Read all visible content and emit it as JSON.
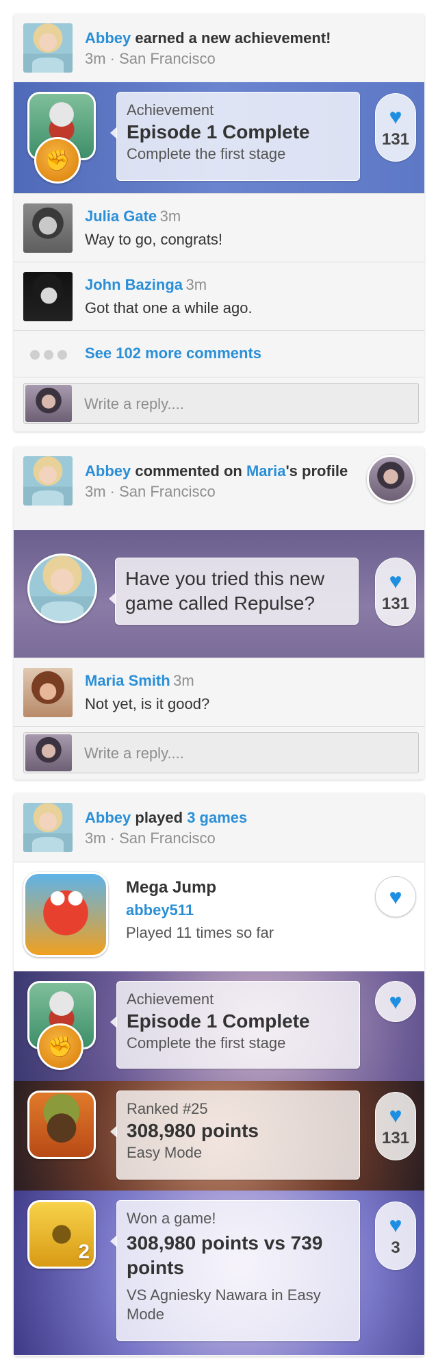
{
  "colors": {
    "link": "#2a8fd6",
    "heart": "#1e8fe0",
    "card_bg": "#f5f5f6"
  },
  "card1": {
    "actor": "Abbey",
    "action": "earned a new achievement!",
    "meta": "3m · San Francisco",
    "achievement": {
      "label": "Achievement",
      "title": "Episode 1 Complete",
      "description": "Complete the first stage",
      "likes": "131"
    },
    "comments": [
      {
        "name": "Julia Gate",
        "time": "3m",
        "text": "Way to go, congrats!"
      },
      {
        "name": "John Bazinga",
        "time": "3m",
        "text": "Got that one a while ago."
      }
    ],
    "more_comments": "See 102 more comments",
    "reply_placeholder": "Write a reply...."
  },
  "card2": {
    "actor": "Abbey",
    "action_pre": "commented on",
    "target": "Maria",
    "action_post": "'s profile",
    "meta": "3m · San Francisco",
    "post_text": "Have you tried this new game called Repulse?",
    "likes": "131",
    "comments": [
      {
        "name": "Maria Smith",
        "time": "3m",
        "text": "Not yet, is it good?"
      }
    ],
    "reply_placeholder": "Write a reply...."
  },
  "card3": {
    "actor": "Abbey",
    "action": "played",
    "games_link": "3 games",
    "meta": "3m · San Francisco",
    "game": {
      "title": "Mega Jump",
      "user": "abbey511",
      "plays": "Played 11 times so far"
    },
    "achievement": {
      "label": "Achievement",
      "title": "Episode 1 Complete",
      "description": "Complete the first stage"
    },
    "ranked": {
      "label": "Ranked #25",
      "title": "308,980 points",
      "mode": "Easy Mode",
      "likes": "131"
    },
    "won": {
      "label": "Won a game!",
      "title": "308,980 points vs 739 points",
      "description": "VS Agniesky Nawara in Easy Mode",
      "likes": "3"
    }
  },
  "icons": {
    "heart": "♥",
    "medal": "✊",
    "temple_badge": "2"
  }
}
